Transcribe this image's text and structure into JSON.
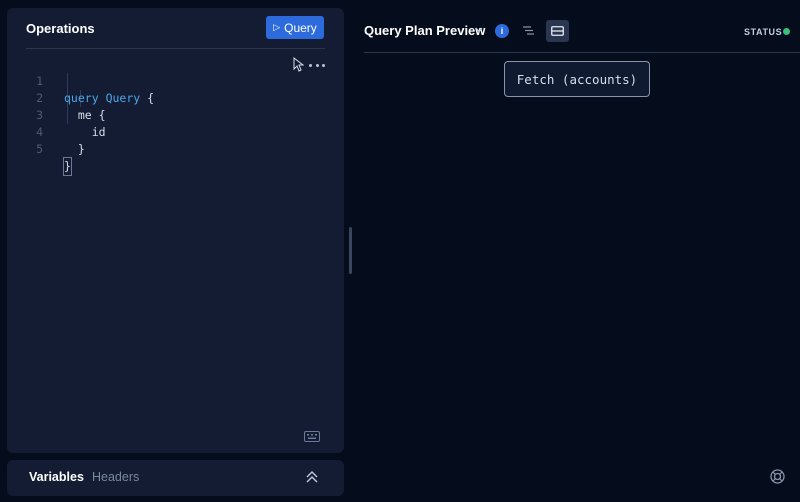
{
  "operations": {
    "title": "Operations",
    "run_button_label": "Query",
    "code_lines": [
      {
        "no": "1",
        "keyword": "query",
        "name": "Query",
        "rest": " {"
      },
      {
        "no": "2",
        "text": "  me {"
      },
      {
        "no": "3",
        "text": "    id"
      },
      {
        "no": "4",
        "text": "  }"
      },
      {
        "no": "5",
        "text": "}"
      }
    ]
  },
  "bottom_tabs": {
    "variables": "Variables",
    "headers": "Headers"
  },
  "plan": {
    "title": "Query Plan Preview",
    "info_badge": "i",
    "status_label": "STATUS",
    "status_color": "#3bbf7a",
    "node_label": "Fetch (accounts)"
  },
  "icons": {
    "run": "play-icon",
    "more": "more-icon",
    "cursor": "cursor-icon",
    "keyboard": "keyboard-icon",
    "collapse": "chevrons-up-icon",
    "dropdown": "chevron-down-icon",
    "info": "info-icon",
    "list_view": "list-view-icon",
    "graph_view": "graph-view-icon",
    "help": "help-icon"
  },
  "colors": {
    "accent": "#2d6bdc",
    "background": "#050c1c",
    "panel": "#131c33",
    "keyword": "#4ea6e8"
  }
}
